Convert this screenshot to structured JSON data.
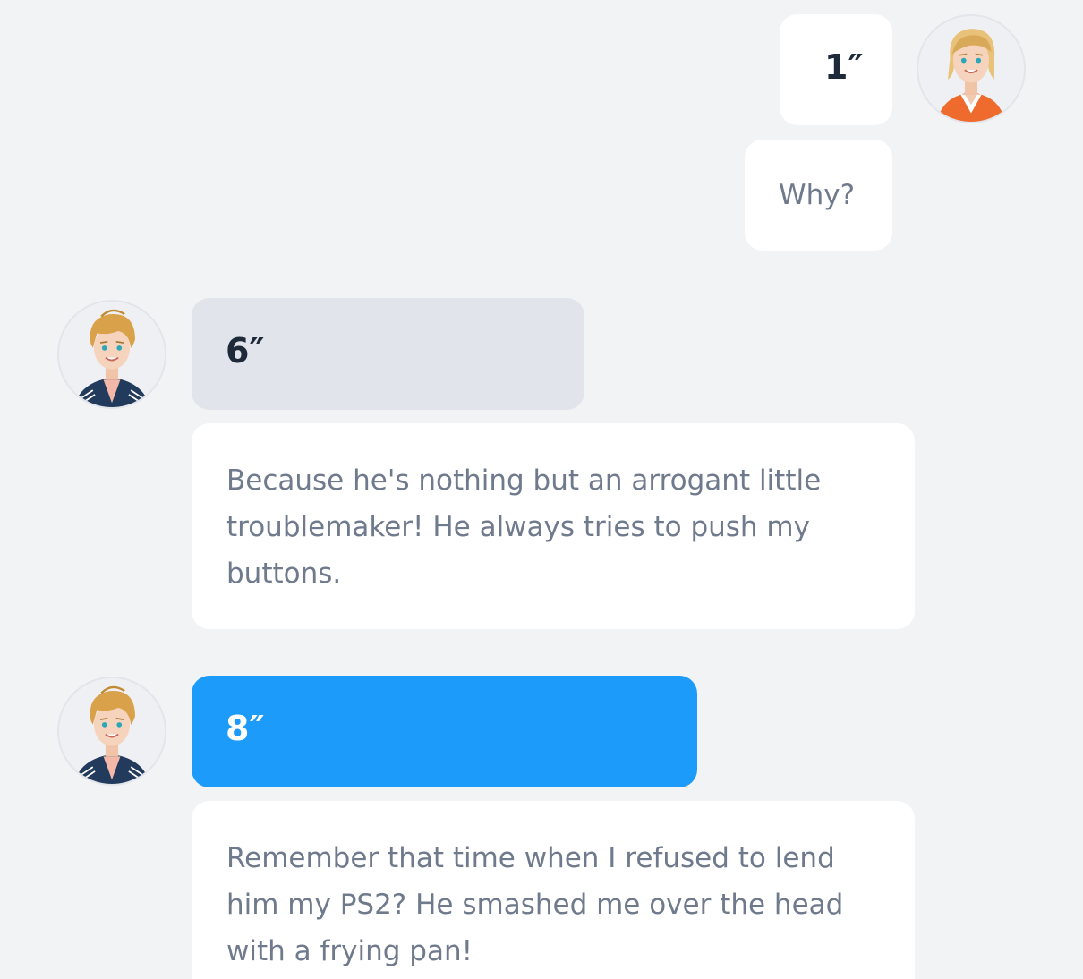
{
  "colors": {
    "background": "#f2f3f5",
    "bubble_white": "#ffffff",
    "bubble_gray": "#e1e5eb",
    "bubble_blue": "#1c9bfb",
    "text_dark": "#1e2a3a",
    "text_muted": "#6f7a8c"
  },
  "messages": [
    {
      "sender": "right-user",
      "avatar_icon": "female-blonde-avatar-icon",
      "duration_label": "1″",
      "text": "Why?"
    },
    {
      "sender": "left-user",
      "avatar_icon": "male-blonde-avatar-icon",
      "duration_label": "6″",
      "text": "Because he's nothing but an arrogant little troublemaker! He always tries to push my buttons."
    },
    {
      "sender": "left-user",
      "avatar_icon": "male-blonde-avatar-icon",
      "duration_label": "8″",
      "text": "Remember that time when I refused to lend him my PS2? He smashed me over the head with a frying pan!"
    }
  ]
}
